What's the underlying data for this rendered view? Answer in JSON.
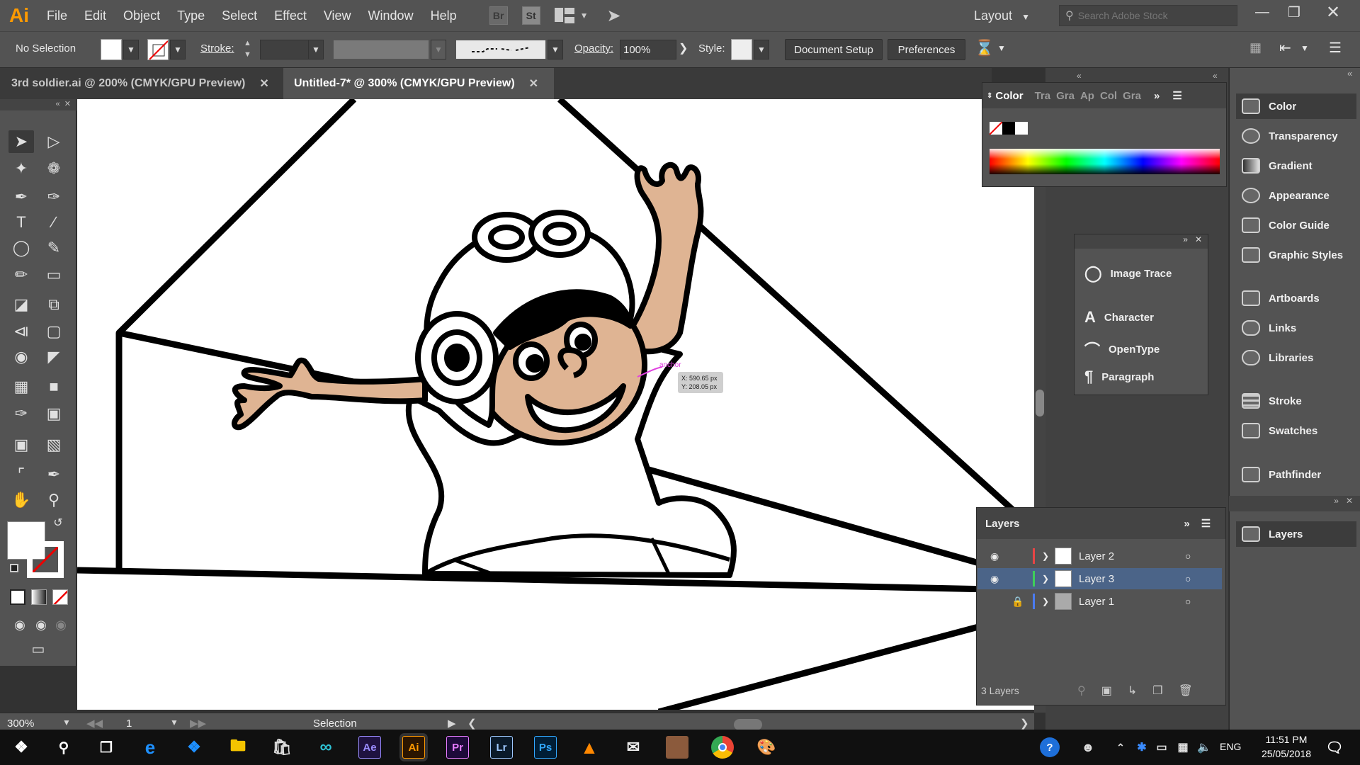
{
  "app": {
    "logo": "Ai"
  },
  "menu": [
    "File",
    "Edit",
    "Object",
    "Type",
    "Select",
    "Effect",
    "View",
    "Window",
    "Help"
  ],
  "bridge_label": "Br",
  "stock_label": "St",
  "workspace": {
    "label": "Layout"
  },
  "search": {
    "placeholder": "Search Adobe Stock"
  },
  "control_bar": {
    "selection": "No Selection",
    "stroke_label": "Stroke:",
    "opacity_label": "Opacity:",
    "opacity_value": "100%",
    "style_label": "Style:",
    "document_setup": "Document Setup",
    "preferences": "Preferences"
  },
  "tabs": [
    {
      "label": "3rd soldier.ai @ 200% (CMYK/GPU Preview)",
      "active": false
    },
    {
      "label": "Untitled-7* @ 300% (CMYK/GPU Preview)",
      "active": true
    }
  ],
  "canvas": {
    "cursor_label": "anchor",
    "coords_x": "X: 590.65 px",
    "coords_y": "Y: 208.05 px",
    "skin_color": "#dfb493"
  },
  "status_bar": {
    "zoom": "300%",
    "page": "1",
    "tool": "Selection"
  },
  "color_panel": {
    "tabs": [
      "Color",
      "Tra",
      "Gra",
      "Ap",
      "Col",
      "Gra"
    ]
  },
  "mid_panel": [
    "Image Trace",
    "Character",
    "OpenType",
    "Paragraph"
  ],
  "dock": {
    "group1": [
      "Color",
      "Transparency",
      "Gradient",
      "Appearance",
      "Color Guide",
      "Graphic Styles"
    ],
    "group2": [
      "Artboards",
      "Links",
      "Libraries"
    ],
    "group3": [
      "Stroke",
      "Swatches"
    ],
    "group4": [
      "Pathfinder"
    ],
    "group5": [
      "Layers"
    ]
  },
  "layers_panel": {
    "title": "Layers",
    "count": "3 Layers",
    "layers": [
      {
        "name": "Layer 2",
        "color": "#e84545",
        "visible": true,
        "locked": false,
        "selected": false
      },
      {
        "name": "Layer 3",
        "color": "#3ecf5a",
        "visible": true,
        "locked": false,
        "selected": true
      },
      {
        "name": "Layer 1",
        "color": "#4a7bf0",
        "visible": false,
        "locked": true,
        "selected": false
      }
    ]
  },
  "taskbar": {
    "apps": [
      "Ae",
      "Ai",
      "Pr",
      "Lr",
      "Ps"
    ],
    "time": "11:51 PM",
    "date": "25/05/2018",
    "language": "ENG"
  }
}
